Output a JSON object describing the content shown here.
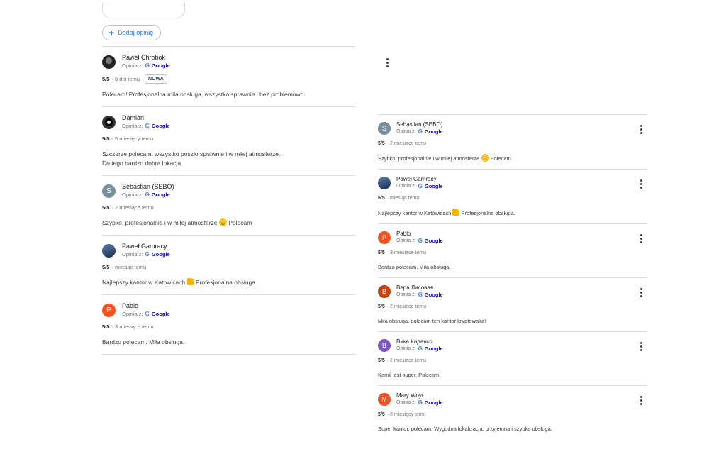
{
  "add_review_label": "Dodaj opinię",
  "google_letter": "G",
  "google_word": "Google",
  "left_reviews": [
    {
      "name": "Paweł Chrobok",
      "source": "Opinia z:",
      "rating": "5/5",
      "date": "· 6 dni temu",
      "badge": "NOWA",
      "text": "Polecam! Profesjonalna miła obsługa, wszystko sprawnie i bez problemowo.",
      "avatar_letter": "",
      "avatar_color": "#222222"
    },
    {
      "name": "Damian",
      "source": "Opinia z:",
      "rating": "5/5",
      "date": "· 5 miesięcy temu",
      "text": "Szczerze polecam, wszystko poszło sprawnie i w miłej atmosferze.",
      "text2": "Do tego bardzo dobra lokacja.",
      "avatar_letter": "",
      "avatar_color": "#111111"
    },
    {
      "name": "Sebastian (SEBO)",
      "source": "Opinia z:",
      "rating": "5/5",
      "date": "· 2 miesiące temu",
      "text": "Szybko, profesjonalnie i w miłej atmosferze",
      "text_after": "Polecam",
      "avatar_letter": "S",
      "avatar_color": "#78909c"
    },
    {
      "name": "Paweł Gamracy",
      "source": "Opinia z:",
      "rating": "5/5",
      "date": "· miesiąc temu",
      "text": "Najlepszy kantor w Katowicach",
      "text_after": "Profesjonalna obsługa.",
      "avatar_letter": "",
      "avatar_color": "#2a3a5c"
    },
    {
      "name": "Pablo",
      "source": "Opinia z:",
      "rating": "5/5",
      "date": "· 3 miesiące temu",
      "text": "Bardzo polecam. Miła obsługa.",
      "avatar_letter": "P",
      "avatar_color": "#f4511e"
    }
  ],
  "right_reviews": [
    {
      "name": "Sebastian (SEBO)",
      "source": "Opinia z:",
      "rating": "5/5",
      "date": "· 2 miesiące temu",
      "text": "Szybko, profesjonalnie i w miłej atmosferze",
      "text_after": "Polecam",
      "avatar_letter": "S",
      "avatar_color": "#78909c"
    },
    {
      "name": "Paweł Gamracy",
      "source": "Opinia z:",
      "rating": "5/5",
      "date": "· miesiąc temu",
      "text": "Najlepszy kantor w Katowicach",
      "text_after": "Profesjonalna obsługa.",
      "avatar_letter": "",
      "avatar_color": "#2a3a5c"
    },
    {
      "name": "Pablo",
      "source": "Opinia z:",
      "rating": "5/5",
      "date": "· 3 miesiące temu",
      "text": "Bardzo polecam. Miła obsługa.",
      "avatar_letter": "P",
      "avatar_color": "#f4511e"
    },
    {
      "name": "Вера Лисовая",
      "source": "Opinia z:",
      "rating": "5/5",
      "date": "· 2 miesiące temu",
      "text": "Miła obsługa, polecam ten kantor kryptowalut!",
      "avatar_letter": "В",
      "avatar_color": "#c2410c"
    },
    {
      "name": "Вика Киденко",
      "source": "Opinia z:",
      "rating": "5/5",
      "date": "· 2 miesiące temu",
      "text": "Kamil jest super. Polecam!",
      "avatar_letter": "В",
      "avatar_color": "#7e57c2"
    },
    {
      "name": "Mary Woyt",
      "source": "Opinia z:",
      "rating": "5/5",
      "date": "· 8 miesięcy temu",
      "text": "Super kantor, polecam. Wygodna lokalizacja, przyjemna i szybka obsługa.",
      "avatar_letter": "M",
      "avatar_color": "#f4511e"
    }
  ]
}
